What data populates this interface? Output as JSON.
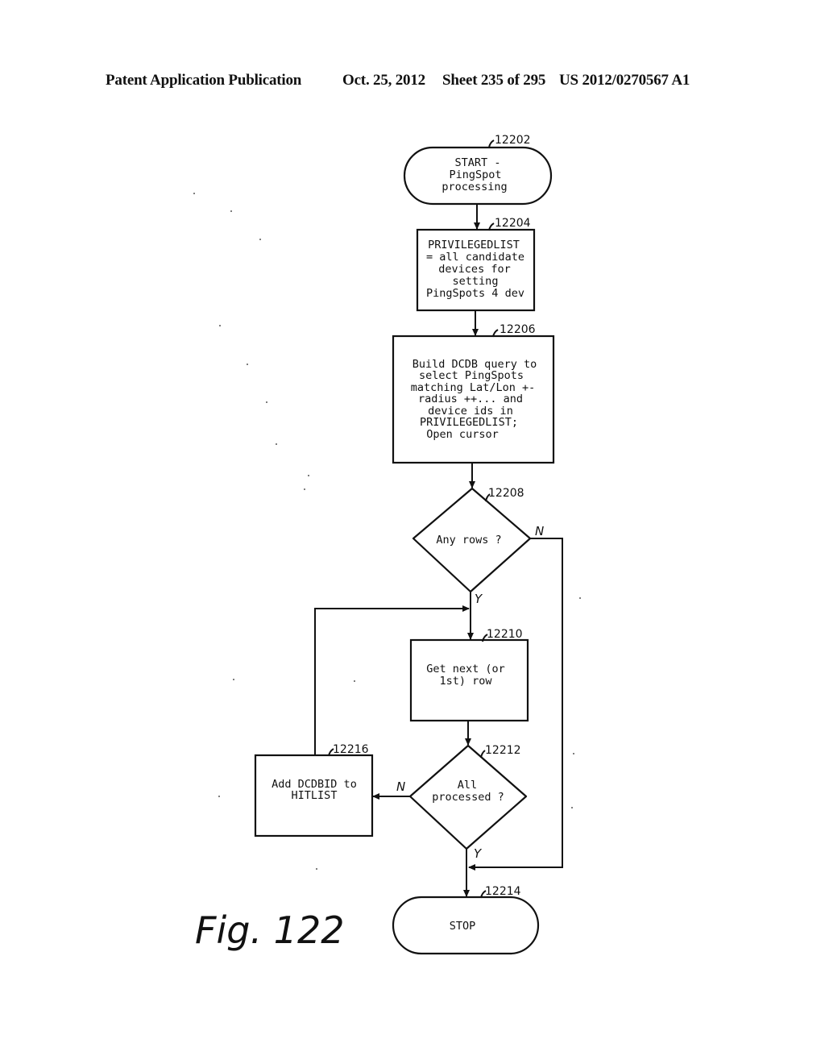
{
  "header": {
    "publication": "Patent Application Publication",
    "date": "Oct. 25, 2012",
    "sheet": "Sheet 235 of 295",
    "patent_number": "US 2012/0270567 A1"
  },
  "figure_label": "Fig. 122",
  "nodes": {
    "start": {
      "ref": "12202",
      "type": "terminal",
      "lines": [
        "START -",
        "PingSpot",
        "processing"
      ]
    },
    "privileged_list": {
      "ref": "12204",
      "type": "process",
      "lines": [
        "PRIVILEGEDLIST",
        "= all candidate",
        "devices for",
        "setting",
        "PingSpots 4 dev"
      ]
    },
    "build_query": {
      "ref": "12206",
      "type": "process",
      "lines": [
        "Build DCDB query to",
        "select PingSpots",
        "matching Lat/Lon +-",
        "radius ++... and",
        "device ids in",
        "PRIVILEGEDLIST;",
        "Open cursor"
      ]
    },
    "any_rows": {
      "ref": "12208",
      "type": "decision",
      "lines": [
        "Any rows ?"
      ]
    },
    "get_next": {
      "ref": "12210",
      "type": "process",
      "lines": [
        "Get next (or",
        "1st) row"
      ]
    },
    "all_processed": {
      "ref": "12212",
      "type": "decision",
      "lines": [
        "All",
        "processed ?"
      ]
    },
    "stop": {
      "ref": "12214",
      "type": "terminal",
      "lines": [
        "STOP"
      ]
    },
    "add_hitlist": {
      "ref": "12216",
      "type": "process",
      "lines": [
        "Add DCDBID to",
        "HITLIST"
      ]
    }
  },
  "edge_labels": {
    "any_rows_no": "N",
    "any_rows_yes": "Y",
    "all_processed_no": "N",
    "all_processed_yes": "Y"
  }
}
